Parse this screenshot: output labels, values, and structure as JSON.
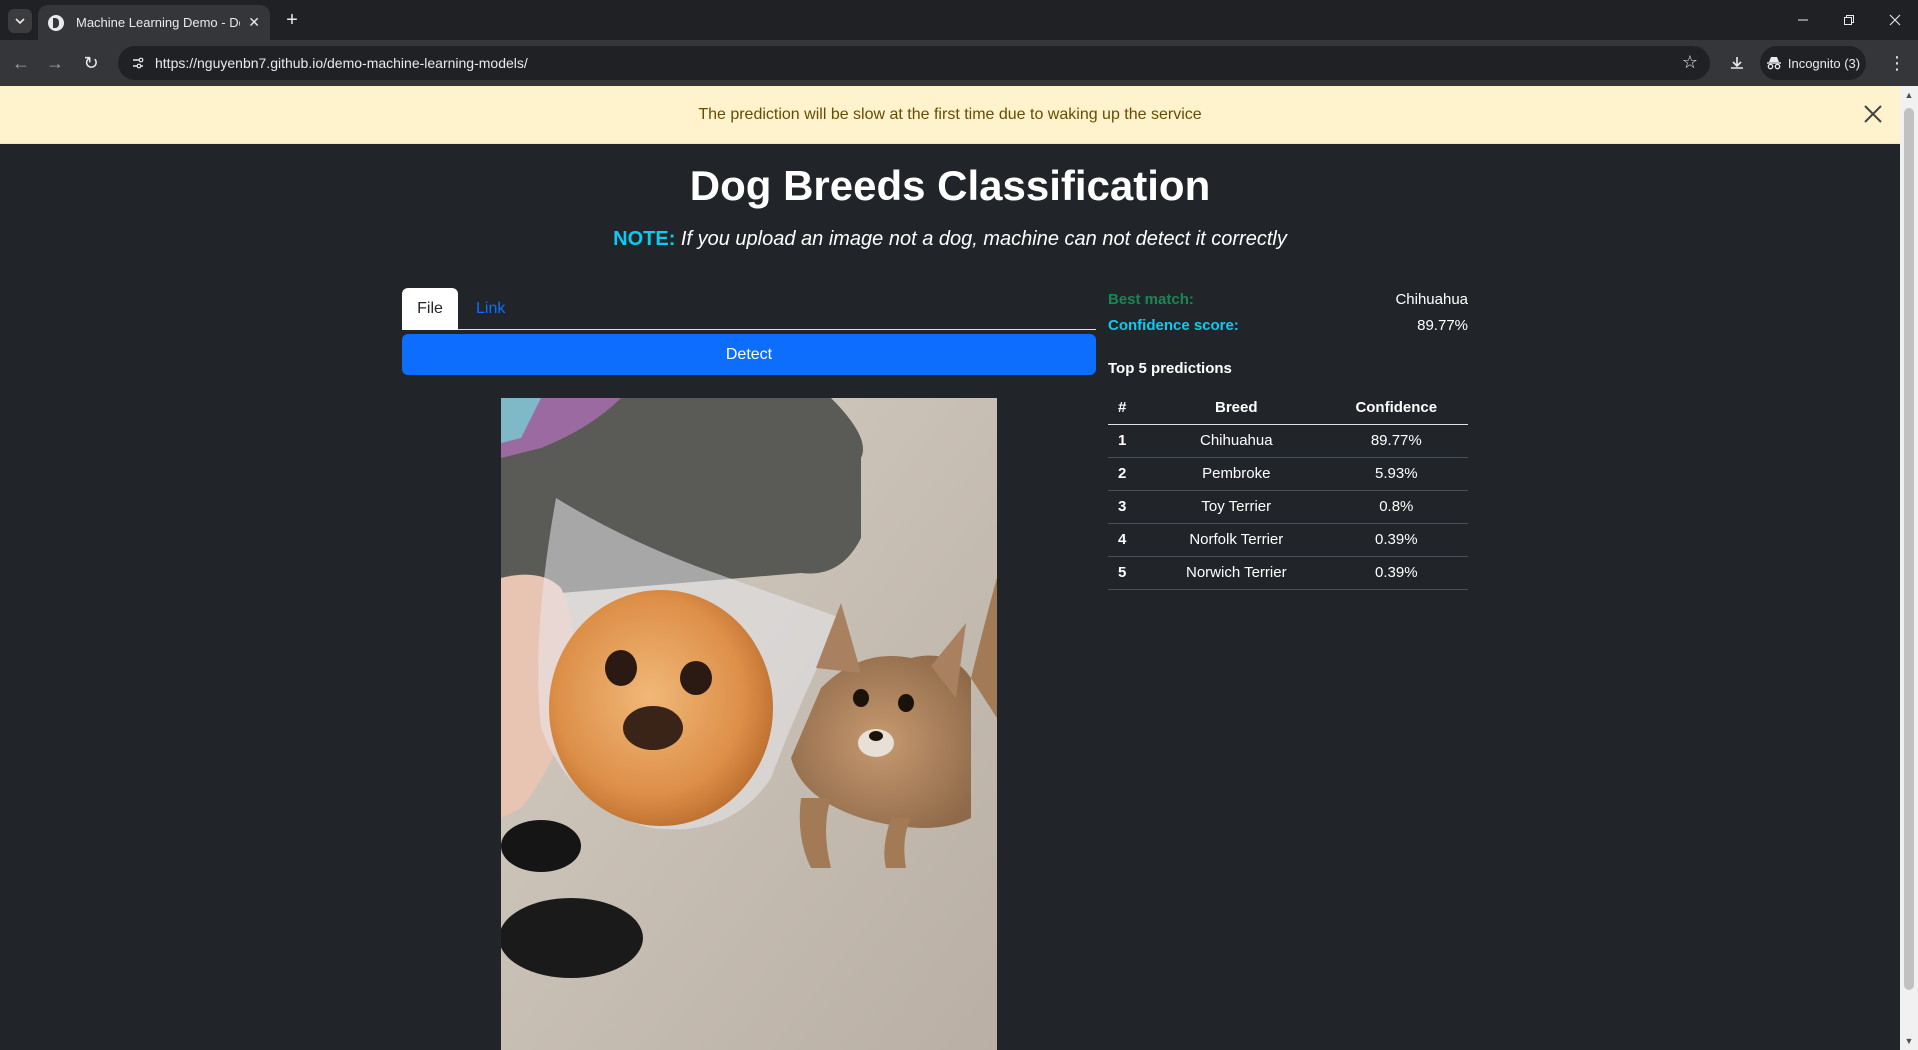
{
  "browser": {
    "tab_title": "Machine Learning Demo - Dog",
    "url": "https://nguyenbn7.github.io/demo-machine-learning-models/",
    "incognito_label": "Incognito (3)"
  },
  "alert": {
    "message": "The prediction will be slow at the first time due to waking up the service"
  },
  "page": {
    "title": "Dog Breeds Classification",
    "note_label": "NOTE:",
    "note_text": "If you upload an image not a dog, machine can not detect it correctly"
  },
  "tabs": {
    "file": "File",
    "link": "Link",
    "active": "File"
  },
  "detect_button": "Detect",
  "result": {
    "best_match_label": "Best match:",
    "best_match_value": "Chihuahua",
    "confidence_label": "Confidence score:",
    "confidence_value": "89.77%",
    "top_title": "Top 5 predictions",
    "columns": [
      "#",
      "Breed",
      "Confidence"
    ],
    "rows": [
      {
        "rank": "1",
        "breed": "Chihuahua",
        "confidence": "89.77%"
      },
      {
        "rank": "2",
        "breed": "Pembroke",
        "confidence": "5.93%"
      },
      {
        "rank": "3",
        "breed": "Toy Terrier",
        "confidence": "0.8%"
      },
      {
        "rank": "4",
        "breed": "Norfolk Terrier",
        "confidence": "0.39%"
      },
      {
        "rank": "5",
        "breed": "Norwich Terrier",
        "confidence": "0.39%"
      }
    ]
  },
  "colors": {
    "page_bg": "#212529",
    "alert_bg": "#fff3cd",
    "primary": "#0d6efd",
    "info": "#0dcaf0",
    "success": "#198754"
  }
}
